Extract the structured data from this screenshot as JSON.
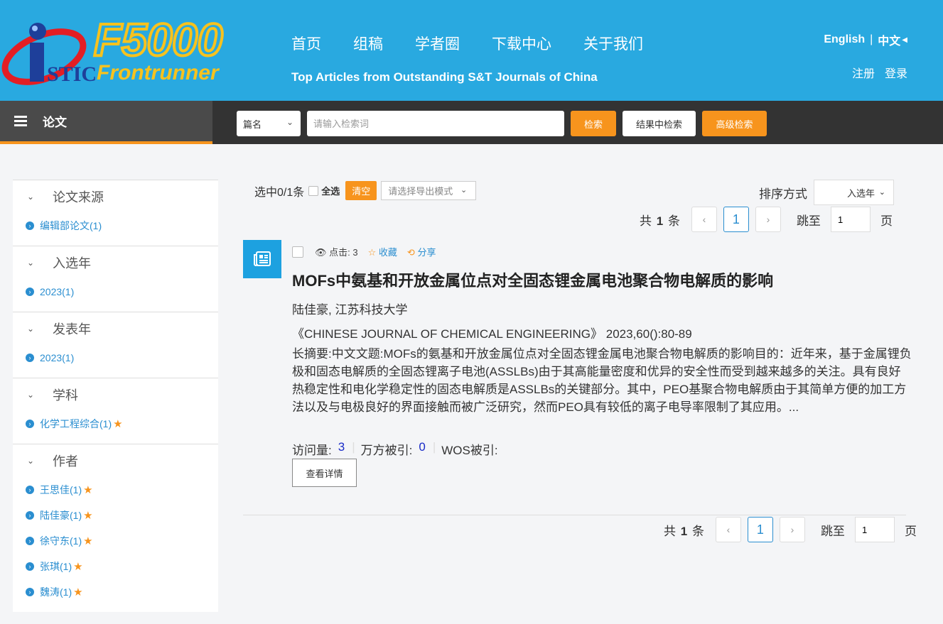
{
  "header": {
    "logo_text": "F5000",
    "logo_sub": "Frontrunner",
    "logo_istic": "STIC",
    "nav": [
      "首页",
      "组稿",
      "学者圈",
      "下载中心",
      "关于我们"
    ],
    "tagline": "Top Articles from Outstanding S&T Journals of China",
    "lang_en": "English",
    "lang_sep": "|",
    "lang_zh": "中文",
    "register": "注册",
    "login": "登录"
  },
  "toolbar": {
    "section_label": "论文",
    "field_select": "篇名",
    "search_placeholder": "请输入检索词",
    "search_btn": "检索",
    "inresult_btn": "结果中检索",
    "advanced_btn": "高级检索"
  },
  "sidebar": {
    "facets": [
      {
        "title": "论文来源",
        "items": [
          {
            "label": "编辑部论文(1)",
            "star": false
          }
        ]
      },
      {
        "title": "入选年",
        "items": [
          {
            "label": "2023(1)",
            "star": false
          }
        ]
      },
      {
        "title": "发表年",
        "items": [
          {
            "label": "2023(1)",
            "star": false
          }
        ]
      },
      {
        "title": "学科",
        "items": [
          {
            "label": "化学工程综合(1)",
            "star": true
          }
        ]
      },
      {
        "title": "作者",
        "items": [
          {
            "label": "王思佳(1)",
            "star": true
          },
          {
            "label": "陆佳豪(1)",
            "star": true
          },
          {
            "label": "徐守东(1)",
            "star": true
          },
          {
            "label": "张琪(1)",
            "star": true
          },
          {
            "label": "魏涛(1)",
            "star": true
          }
        ]
      }
    ]
  },
  "results": {
    "selected_text": "选中0/1条",
    "select_all": "全选",
    "clear_btn": "清空",
    "export_placeholder": "请选择导出模式",
    "sort_label": "排序方式",
    "sort_value": "入选年",
    "pager": {
      "count_prefix": "共",
      "count": "1",
      "count_suffix": "条",
      "prev": "‹",
      "current": "1",
      "next": "›",
      "jump_label": "跳至",
      "jump_value": "1",
      "page_unit": "页"
    },
    "article": {
      "views_label": "点击: 3",
      "fav_label": "收藏",
      "share_label": "分享",
      "title": "MOFs中氨基和开放金属位点对全固态锂金属电池聚合物电解质的影响",
      "authors": "陆佳豪, 江苏科技大学",
      "journal": "《CHINESE JOURNAL OF CHEMICAL ENGINEERING》 2023,60():80-89",
      "abstract": "长摘要:中文文题:MOFs的氨基和开放金属位点对全固态锂金属电池聚合物电解质的影响目的：近年来，基于金属锂负极和固态电解质的全固态锂离子电池(ASSLBs)由于其高能量密度和优异的安全性而受到越来越多的关注。具有良好热稳定性和电化学稳定性的固态电解质是ASSLBs的关键部分。其中，PEO基聚合物电解质由于其简单方便的加工方法以及与电极良好的界面接触而被广泛研究，然而PEO具有较低的离子电导率限制了其应用。...",
      "visits_label": "访问量:",
      "visits": "3",
      "wanfang_label": "万方被引:",
      "wanfang": "0",
      "wos_label": "WOS被引:",
      "detail_btn": "查看详情"
    }
  },
  "colors": {
    "header_bg": "#29a9e0",
    "accent": "#f7941d",
    "link": "#2a8ed0"
  }
}
